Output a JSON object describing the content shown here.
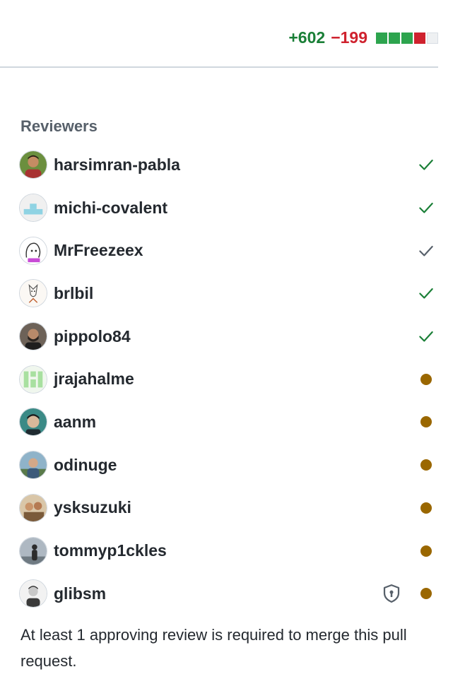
{
  "diffstat": {
    "additions": "+602",
    "deletions": "−199",
    "blocks": [
      "green",
      "green",
      "green",
      "red",
      "neutral"
    ]
  },
  "reviewers_section": {
    "title": "Reviewers",
    "items": [
      {
        "name": "harsimran-pabla",
        "status": "approved",
        "status_icon": "check-icon",
        "status_color": "#1a7f37"
      },
      {
        "name": "michi-covalent",
        "status": "approved",
        "status_icon": "check-icon",
        "status_color": "#1a7f37"
      },
      {
        "name": "MrFreezeex",
        "status": "commented",
        "status_icon": "check-icon",
        "status_color": "#57606a"
      },
      {
        "name": "brlbil",
        "status": "approved",
        "status_icon": "check-icon",
        "status_color": "#1a7f37"
      },
      {
        "name": "pippolo84",
        "status": "approved",
        "status_icon": "check-icon",
        "status_color": "#1a7f37"
      },
      {
        "name": "jrajahalme",
        "status": "pending",
        "status_icon": "dot-icon",
        "status_color": "#9a6700"
      },
      {
        "name": "aanm",
        "status": "pending",
        "status_icon": "dot-icon",
        "status_color": "#9a6700"
      },
      {
        "name": "odinuge",
        "status": "pending",
        "status_icon": "dot-icon",
        "status_color": "#9a6700"
      },
      {
        "name": "ysksuzuki",
        "status": "pending",
        "status_icon": "dot-icon",
        "status_color": "#9a6700"
      },
      {
        "name": "tommyp1ckles",
        "status": "pending",
        "status_icon": "dot-icon",
        "status_color": "#9a6700"
      },
      {
        "name": "glibsm",
        "status": "pending",
        "status_icon": "dot-icon",
        "status_color": "#9a6700",
        "code_owner_icon": "shield-lock-icon"
      }
    ]
  },
  "note": "At least 1 approving review is required to merge this pull request."
}
